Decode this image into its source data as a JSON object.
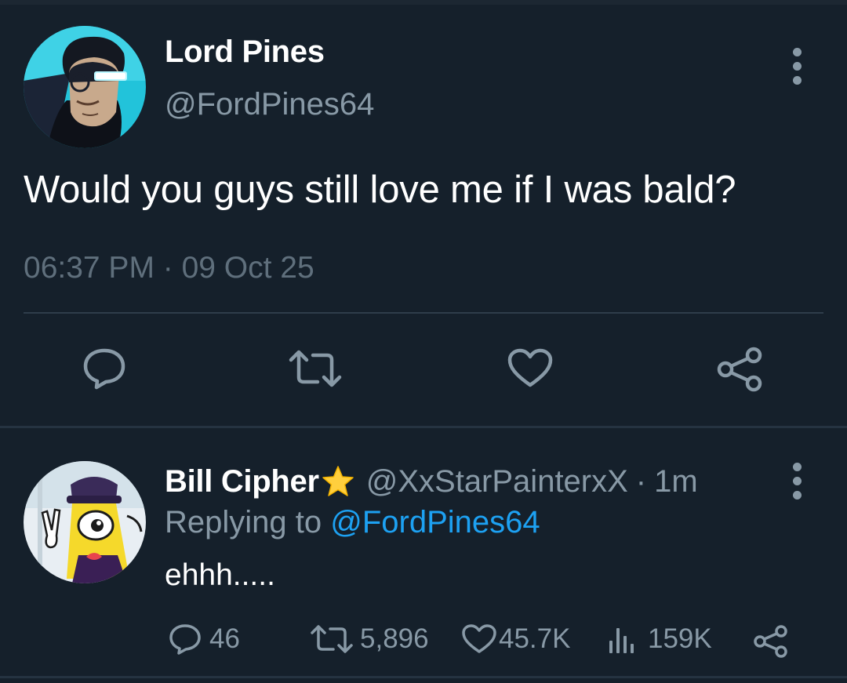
{
  "main_tweet": {
    "author": {
      "display_name": "Lord Pines",
      "handle": "@FordPines64"
    },
    "text": "Would you guys still love me if I was bald?",
    "timestamp": "06:37 PM · 09 Oct 25",
    "actions": [
      "reply-icon",
      "retweet-icon",
      "like-icon",
      "share-icon"
    ]
  },
  "reply": {
    "author": {
      "display_name": "Bill Cipher",
      "badge": "star-emoji",
      "handle": "@XxStarPainterxX",
      "separator": "·",
      "time": "1m"
    },
    "replying_label": "Replying to",
    "replying_to": "@FordPines64",
    "text": "ehhh.....",
    "stats": {
      "replies": "46",
      "retweets": "5,896",
      "likes": "45.7K",
      "views": "159K"
    }
  },
  "colors": {
    "background": "#15202b",
    "secondary_text": "#8899a6",
    "link": "#1da1f2",
    "divider": "#2f3d4a"
  }
}
